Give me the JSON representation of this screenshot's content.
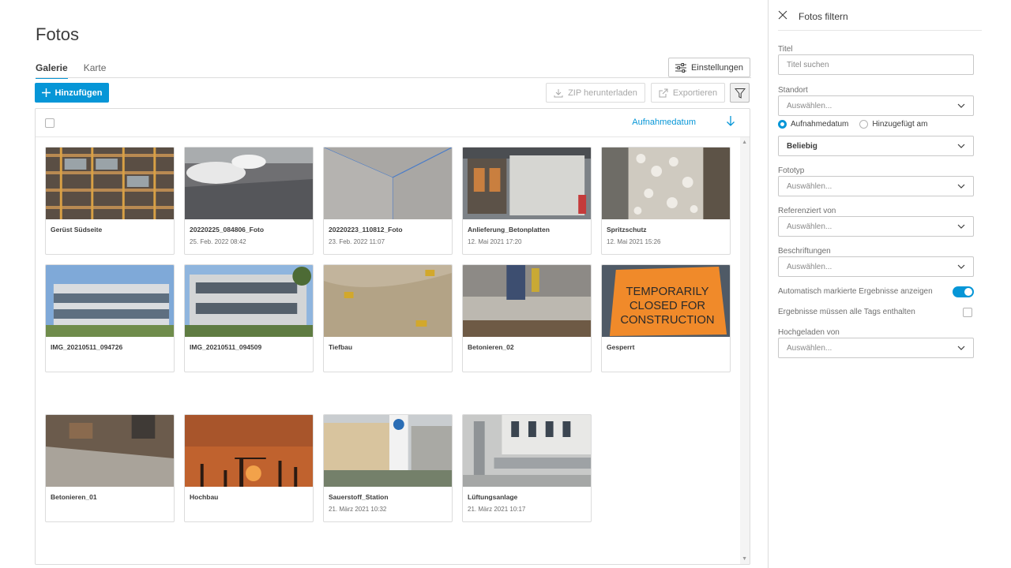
{
  "page": {
    "title": "Fotos"
  },
  "tabs": [
    {
      "label": "Galerie",
      "active": true
    },
    {
      "label": "Karte",
      "active": false
    }
  ],
  "toolbar": {
    "settings_label": "Einstellungen",
    "add_label": "Hinzufügen",
    "zip_label": "ZIP herunterladen",
    "export_label": "Exportieren"
  },
  "gallery": {
    "sort_label": "Aufnahmedatum",
    "photos": [
      {
        "title": "Gerüst Südseite",
        "date": "",
        "image": "scaffold-facade"
      },
      {
        "title": "20220225_084806_Foto",
        "date": "25. Feb. 2022 08:42",
        "image": "parked-cars"
      },
      {
        "title": "20220223_110812_Foto",
        "date": "23. Feb. 2022 11:07",
        "image": "room-corner"
      },
      {
        "title": "Anlieferung_Betonplatten",
        "date": "12. Mai 2021 17:20",
        "image": "concrete-panels"
      },
      {
        "title": "Spritzschutz",
        "date": "12. Mai 2021 15:26",
        "image": "gravel"
      },
      {
        "title": "IMG_20210511_094726",
        "date": "",
        "image": "office-building"
      },
      {
        "title": "IMG_20210511_094509",
        "date": "",
        "image": "office-building-2"
      },
      {
        "title": "Tiefbau",
        "date": "",
        "image": "excavation"
      },
      {
        "title": "Betonieren_02",
        "date": "",
        "image": "concrete-pouring"
      },
      {
        "title": "Gesperrt",
        "date": "",
        "image": "closed-sign",
        "sign_text": [
          "TEMPORARILY",
          "CLOSED FOR",
          "CONSTRUCTION"
        ]
      },
      {
        "title": "Betonieren_01",
        "date": "",
        "image": "concrete-leveling"
      },
      {
        "title": "Hochbau",
        "date": "",
        "image": "sunset-cranes"
      },
      {
        "title": "Sauerstoff_Station",
        "date": "21. März 2021 10:32",
        "image": "oxygen-station"
      },
      {
        "title": "Lüftungsanlage",
        "date": "21. März 2021 10:17",
        "image": "ventilation"
      }
    ]
  },
  "filter_panel": {
    "title": "Fotos filtern",
    "title_label": "Titel",
    "title_placeholder": "Titel suchen",
    "location_label": "Standort",
    "location_value": "Auswählen...",
    "date_options": [
      {
        "label": "Aufnahmedatum",
        "selected": true
      },
      {
        "label": "Hinzugefügt am",
        "selected": false
      }
    ],
    "date_value": "Beliebig",
    "phototype_label": "Fototyp",
    "phototype_value": "Auswählen...",
    "referenced_label": "Referenziert von",
    "referenced_value": "Auswählen...",
    "labels_label": "Beschriftungen",
    "labels_value": "Auswählen...",
    "auto_tagged_label": "Automatisch markierte Ergebnisse anzeigen",
    "auto_tagged_on": true,
    "all_tags_label": "Ergebnisse müssen alle Tags enthalten",
    "all_tags_checked": false,
    "uploaded_label": "Hochgeladen von",
    "uploaded_value": "Auswählen..."
  },
  "colors": {
    "accent": "#0696d7",
    "border": "#dcdcdc",
    "text": "#3c3c3c"
  }
}
